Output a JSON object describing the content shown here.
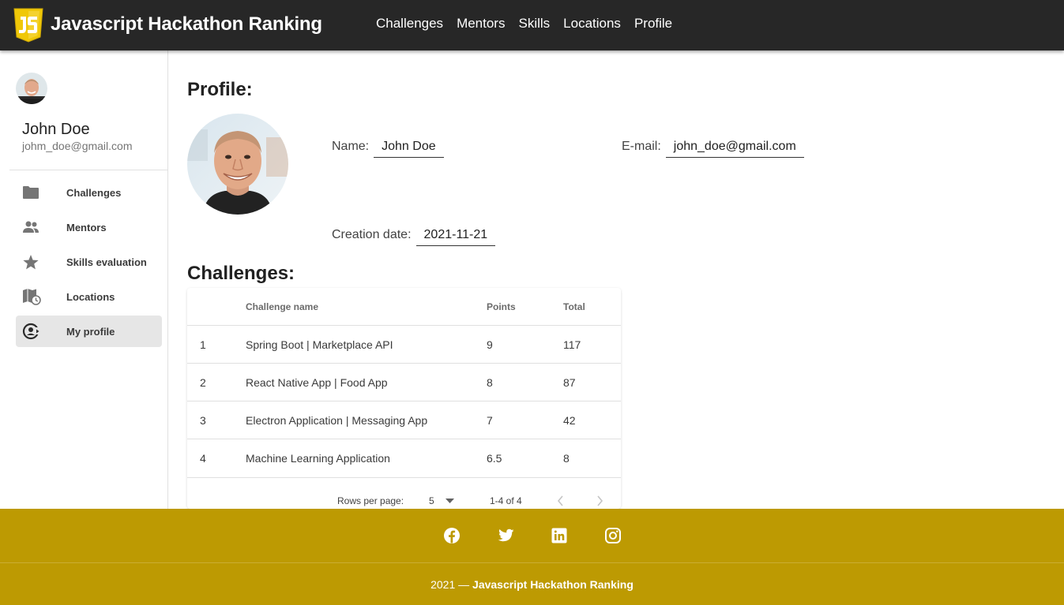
{
  "header": {
    "title": "Javascript Hackathon Ranking",
    "nav": [
      "Challenges",
      "Mentors",
      "Skills",
      "Locations",
      "Profile"
    ]
  },
  "sidebar": {
    "user_name": "John Doe",
    "user_email": "johm_doe@gmail.com",
    "items": [
      {
        "label": "Challenges",
        "icon": "folder-icon"
      },
      {
        "label": "Mentors",
        "icon": "people-icon"
      },
      {
        "label": "Skills evaluation",
        "icon": "star-icon"
      },
      {
        "label": "Locations",
        "icon": "map-clock-icon"
      },
      {
        "label": "My profile",
        "icon": "account-sync-icon",
        "active": true
      }
    ]
  },
  "profile": {
    "heading": "Profile:",
    "name_label": "Name:",
    "name_value": "John Doe",
    "email_label": "E-mail:",
    "email_value": "john_doe@gmail.com",
    "date_label": "Creation date:",
    "date_value": "2021-11-21"
  },
  "challenges": {
    "heading": "Challenges:",
    "columns": [
      "",
      "Challenge name",
      "Points",
      "Total"
    ],
    "rows": [
      [
        "1",
        "Spring Boot | Marketplace API",
        "9",
        "117"
      ],
      [
        "2",
        "React Native App | Food App",
        "8",
        "87"
      ],
      [
        "3",
        "Electron Application | Messaging App",
        "7",
        "42"
      ],
      [
        "4",
        "Machine Learning Application",
        "6.5",
        "8"
      ]
    ],
    "pagination": {
      "rows_per_page_label": "Rows per page:",
      "rows_per_page_value": "5",
      "range": "1-4 of 4"
    }
  },
  "footer": {
    "socials": [
      "facebook-icon",
      "twitter-icon",
      "linkedin-icon",
      "instagram-icon"
    ],
    "year": "2021",
    "separator": "—",
    "brand": "Javascript Hackathon Ranking",
    "background": "#bd9a02"
  },
  "colors": {
    "appbar": "#272727",
    "logo_yellow": "#f0c808",
    "active_item": "#e6e6e6"
  }
}
